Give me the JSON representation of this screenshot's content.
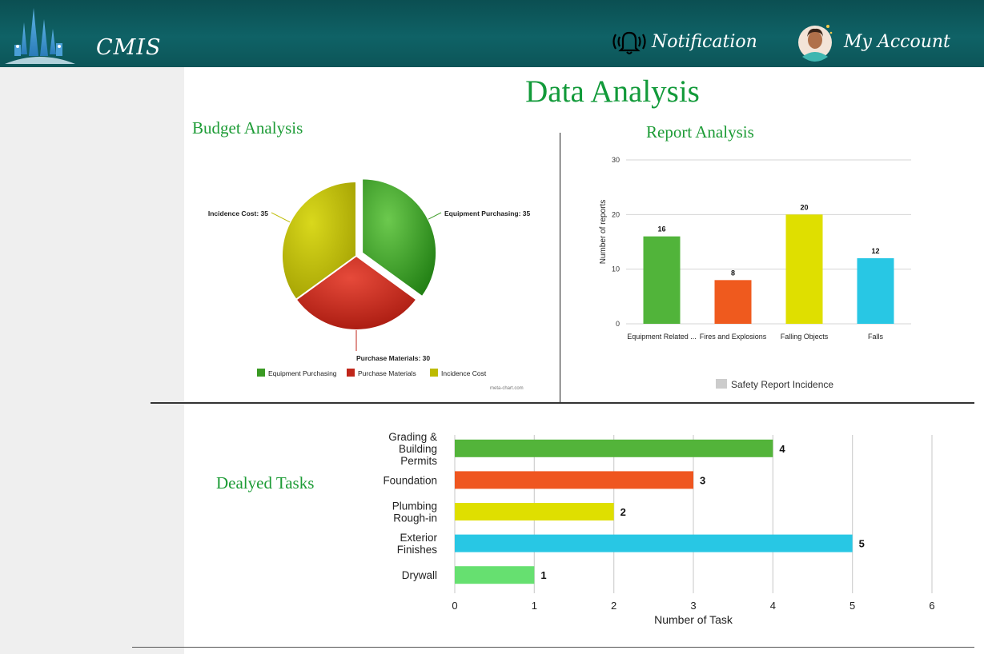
{
  "header": {
    "brand": "CMIS",
    "notification_label": "Notification",
    "account_label": "My Account",
    "colors": {
      "bar": "#0f5e61",
      "text": "#ffffff"
    }
  },
  "page": {
    "title": "Data Analysis"
  },
  "sections": {
    "budget": "Budget Analysis",
    "report": "Report Analysis",
    "delayed": "Dealyed Tasks"
  },
  "chart_data": [
    {
      "type": "pie",
      "categories": [
        "Equipment Purchasing",
        "Purchase Materials",
        "Incidence Cost"
      ],
      "values": [
        35,
        30,
        35
      ],
      "slice_labels": [
        "Equipment Purchasing: 35",
        "Purchase Materials: 30",
        "Incidence Cost: 35"
      ],
      "colors": [
        "#3a9a23",
        "#c0261a",
        "#bdbb00"
      ],
      "legend": "bottom",
      "credit": "meta-chart.com"
    },
    {
      "type": "bar",
      "categories": [
        "Equipment Related ...",
        "Fires and Explosions",
        "Falling Objects",
        "Falls"
      ],
      "values": [
        16,
        8,
        20,
        12
      ],
      "colors": [
        "#51b43a",
        "#ef5a1e",
        "#dfdf00",
        "#28c7e4"
      ],
      "ylabel": "Number of reports",
      "ylim": [
        0,
        30
      ],
      "yticks": [
        0,
        10,
        20,
        30
      ],
      "legend_label": "Safety Report Incidence",
      "legend": "bottom",
      "grid": true
    },
    {
      "type": "bar",
      "orientation": "horizontal",
      "categories": [
        "Grading &\nBuilding\nPermits",
        "Foundation",
        "Plumbing\nRough-in",
        "Exterior\nFinishes",
        "Drywall"
      ],
      "values": [
        4,
        3,
        2,
        5,
        1
      ],
      "colors": [
        "#53b43a",
        "#ef5620",
        "#dfdf00",
        "#28c7e4",
        "#66e070"
      ],
      "xlabel": "Number of Task",
      "xlim": [
        0,
        6
      ],
      "xticks": [
        0,
        1,
        2,
        3,
        4,
        5,
        6
      ],
      "grid": true
    }
  ]
}
